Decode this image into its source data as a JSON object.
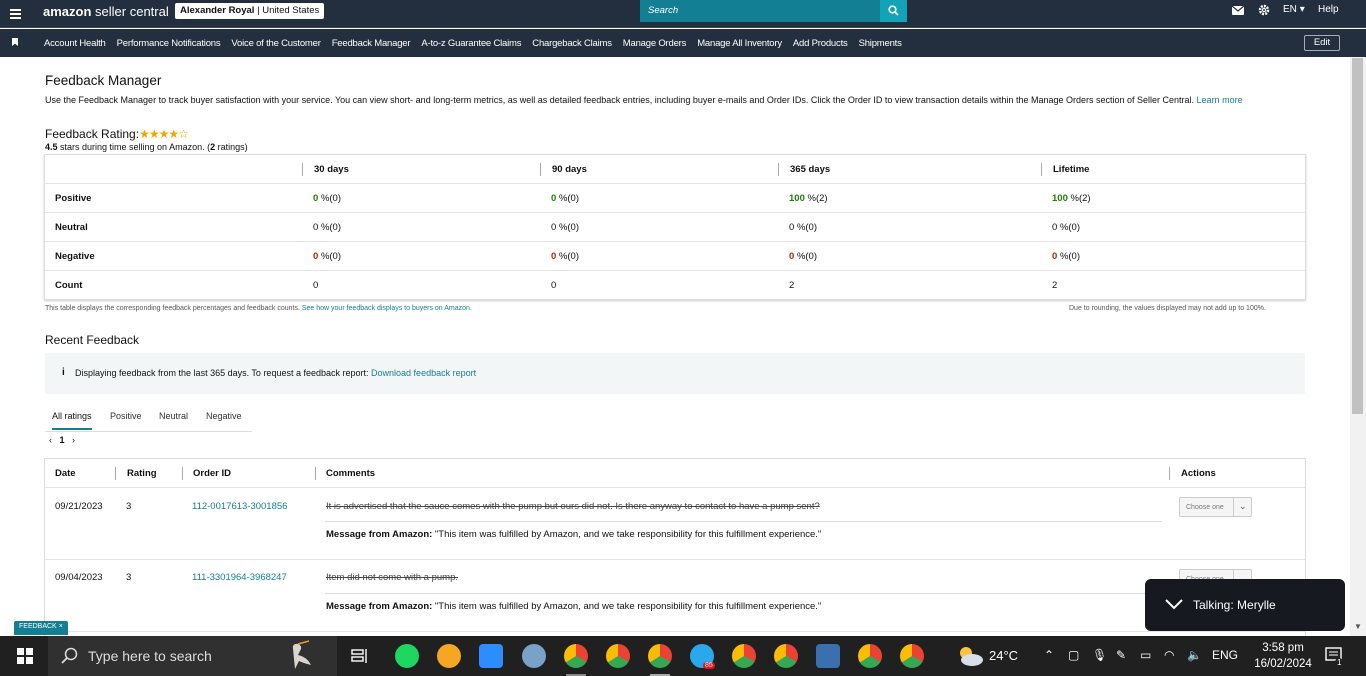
{
  "header": {
    "logo_main": "amazon",
    "logo_sub": "seller central",
    "account_name": "Alexander Royal",
    "account_region": "United States",
    "search_placeholder": "Search",
    "lang": "EN",
    "help": "Help"
  },
  "nav": {
    "items": [
      "Account Health",
      "Performance Notifications",
      "Voice of the Customer",
      "Feedback Manager",
      "A-to-z Guarantee Claims",
      "Chargeback Claims",
      "Manage Orders",
      "Manage All Inventory",
      "Add Products",
      "Shipments"
    ],
    "edit": "Edit"
  },
  "page": {
    "title": "Feedback Manager",
    "description": "Use the Feedback Manager to track buyer satisfaction with your service. You can view short- and long-term metrics, as well as detailed feedback entries, including buyer e-mails and Order IDs. Click the Order ID to view transaction details within the Manage Orders section of Seller Central.",
    "learn_more": "Learn more",
    "rating_label": "Feedback Rating:",
    "stars": 4.5,
    "stars_value": "4.5",
    "stars_text": " stars during time selling on Amazon. (",
    "ratings_count": "2",
    "ratings_suffix": " ratings)"
  },
  "metrics": {
    "headers": [
      "30 days",
      "90 days",
      "365 days",
      "Lifetime"
    ],
    "rows": [
      {
        "label": "Positive",
        "cells": [
          {
            "v": "0",
            "t": "%(0)"
          },
          {
            "v": "0",
            "t": "%(0)"
          },
          {
            "v": "100",
            "t": "%(2)"
          },
          {
            "v": "100",
            "t": "%(2)"
          }
        ]
      },
      {
        "label": "Neutral",
        "cells": [
          {
            "v": "0",
            "t": "%(0)"
          },
          {
            "v": "0",
            "t": "%(0)"
          },
          {
            "v": "0",
            "t": "%(0)"
          },
          {
            "v": "0",
            "t": "%(0)"
          }
        ]
      },
      {
        "label": "Negative",
        "cells": [
          {
            "v": "0",
            "t": "%(0)"
          },
          {
            "v": "0",
            "t": "%(0)"
          },
          {
            "v": "0",
            "t": "%(0)"
          },
          {
            "v": "0",
            "t": "%(0)"
          }
        ]
      },
      {
        "label": "Count",
        "cells": [
          {
            "v": "0",
            "t": ""
          },
          {
            "v": "0",
            "t": ""
          },
          {
            "v": "2",
            "t": ""
          },
          {
            "v": "2",
            "t": ""
          }
        ]
      }
    ],
    "footnote": "This table displays the corresponding feedback percentages and feedback counts.",
    "footnote_link": "See how your feedback displays to buyers on Amazon.",
    "rounding_note": "Due to rounding, the values displayed may not add up to 100%."
  },
  "recent": {
    "title": "Recent Feedback",
    "info_text": "Displaying feedback from the last 365 days. To request a feedback report:",
    "info_link": "Download feedback report",
    "tabs": [
      "All ratings",
      "Positive",
      "Neutral",
      "Negative"
    ],
    "page": "1",
    "columns": [
      "Date",
      "Rating",
      "Order ID",
      "Comments",
      "Actions"
    ],
    "rows": [
      {
        "date": "09/21/2023",
        "rating": "3",
        "order_id": "112-0017613-3001856",
        "comment": "It is advertised that the sauce comes with the pump but ours did not. Is there anyway to contact to have a pump sent?",
        "msg_label": "Message from Amazon:",
        "msg": "\"This item was fulfilled by Amazon, and we take responsibility for this fulfillment experience.\"",
        "action": "Choose one"
      },
      {
        "date": "09/04/2023",
        "rating": "3",
        "order_id": "111-3301964-3968247",
        "comment": "Item did not come with a pump.",
        "msg_label": "Message from Amazon:",
        "msg": "\"This item was fulfilled by Amazon, and we take responsibility for this fulfillment experience.\"",
        "action": "Choose one"
      }
    ]
  },
  "toast": {
    "text": "Talking: Merylle"
  },
  "feedback_badge": "FEEDBACK",
  "taskbar": {
    "search_placeholder": "Type here to search",
    "temperature": "24°C",
    "lang": "ENG",
    "time": "3:58 pm",
    "date": "16/02/2024",
    "telegram_badge": "85",
    "notification_count": "1"
  },
  "colors": {
    "header_bg": "#232f3e",
    "accent": "#127f95",
    "positive": "#1d8102",
    "negative": "#b12704",
    "star": "#f0a500"
  }
}
